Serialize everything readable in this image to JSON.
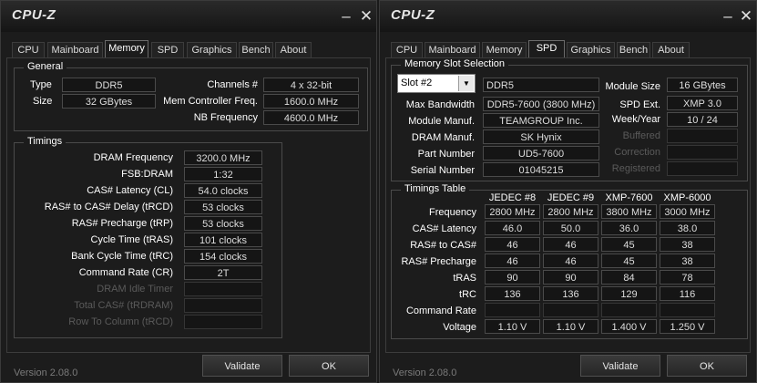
{
  "app_title": "CPU-Z",
  "titlebar": {
    "minimize_glyph": "–",
    "close_glyph": "✕"
  },
  "tabs": [
    "CPU",
    "Mainboard",
    "Memory",
    "SPD",
    "Graphics",
    "Bench",
    "About"
  ],
  "memory": {
    "general": {
      "title": "General",
      "type_label": "Type",
      "type_value": "DDR5",
      "size_label": "Size",
      "size_value": "32 GBytes",
      "channels_label": "Channels #",
      "channels_value": "4 x 32-bit",
      "mcf_label": "Mem Controller Freq.",
      "mcf_value": "1600.0 MHz",
      "nb_label": "NB Frequency",
      "nb_value": "4600.0 MHz"
    },
    "timings": {
      "title": "Timings",
      "rows": [
        {
          "label": "DRAM Frequency",
          "value": "3200.0 MHz"
        },
        {
          "label": "FSB:DRAM",
          "value": "1:32"
        },
        {
          "label": "CAS# Latency (CL)",
          "value": "54.0 clocks"
        },
        {
          "label": "RAS# to CAS# Delay (tRCD)",
          "value": "53 clocks"
        },
        {
          "label": "RAS# Precharge (tRP)",
          "value": "53 clocks"
        },
        {
          "label": "Cycle Time (tRAS)",
          "value": "101 clocks"
        },
        {
          "label": "Bank Cycle Time (tRC)",
          "value": "154 clocks"
        },
        {
          "label": "Command Rate (CR)",
          "value": "2T"
        },
        {
          "label": "DRAM Idle Timer",
          "value": ""
        },
        {
          "label": "Total CAS# (tRDRAM)",
          "value": ""
        },
        {
          "label": "Row To Column (tRCD)",
          "value": ""
        }
      ]
    }
  },
  "spd": {
    "slot": {
      "title": "Memory Slot Selection",
      "selected": "Slot #2",
      "type_value": "DDR5",
      "max_bw_label": "Max Bandwidth",
      "max_bw_value": "DDR5-7600 (3800 MHz)",
      "manuf_label": "Module Manuf.",
      "manuf_value": "TEAMGROUP Inc.",
      "dram_manuf_label": "DRAM Manuf.",
      "dram_manuf_value": "SK Hynix",
      "part_label": "Part Number",
      "part_value": "UD5-7600",
      "serial_label": "Serial Number",
      "serial_value": "01045215",
      "module_size_label": "Module Size",
      "module_size_value": "16 GBytes",
      "spd_ext_label": "SPD Ext.",
      "spd_ext_value": "XMP 3.0",
      "week_year_label": "Week/Year",
      "week_year_value": "10 / 24",
      "buffered_label": "Buffered",
      "correction_label": "Correction",
      "registered_label": "Registered"
    },
    "timings_table": {
      "title": "Timings Table",
      "columns": [
        "JEDEC #8",
        "JEDEC #9",
        "XMP-7600",
        "XMP-6000"
      ],
      "rows": [
        {
          "label": "Frequency",
          "values": [
            "2800 MHz",
            "2800 MHz",
            "3800 MHz",
            "3000 MHz"
          ]
        },
        {
          "label": "CAS# Latency",
          "values": [
            "46.0",
            "50.0",
            "36.0",
            "38.0"
          ]
        },
        {
          "label": "RAS# to CAS#",
          "values": [
            "46",
            "46",
            "45",
            "38"
          ]
        },
        {
          "label": "RAS# Precharge",
          "values": [
            "46",
            "46",
            "45",
            "38"
          ]
        },
        {
          "label": "tRAS",
          "values": [
            "90",
            "90",
            "84",
            "78"
          ]
        },
        {
          "label": "tRC",
          "values": [
            "136",
            "136",
            "129",
            "116"
          ]
        },
        {
          "label": "Command Rate",
          "values": [
            "",
            "",
            "",
            ""
          ]
        },
        {
          "label": "Voltage",
          "values": [
            "1.10 V",
            "1.10 V",
            "1.400 V",
            "1.250 V"
          ]
        }
      ]
    }
  },
  "footer": {
    "version": "Version 2.08.0",
    "validate_label": "Validate",
    "ok_label": "OK"
  }
}
